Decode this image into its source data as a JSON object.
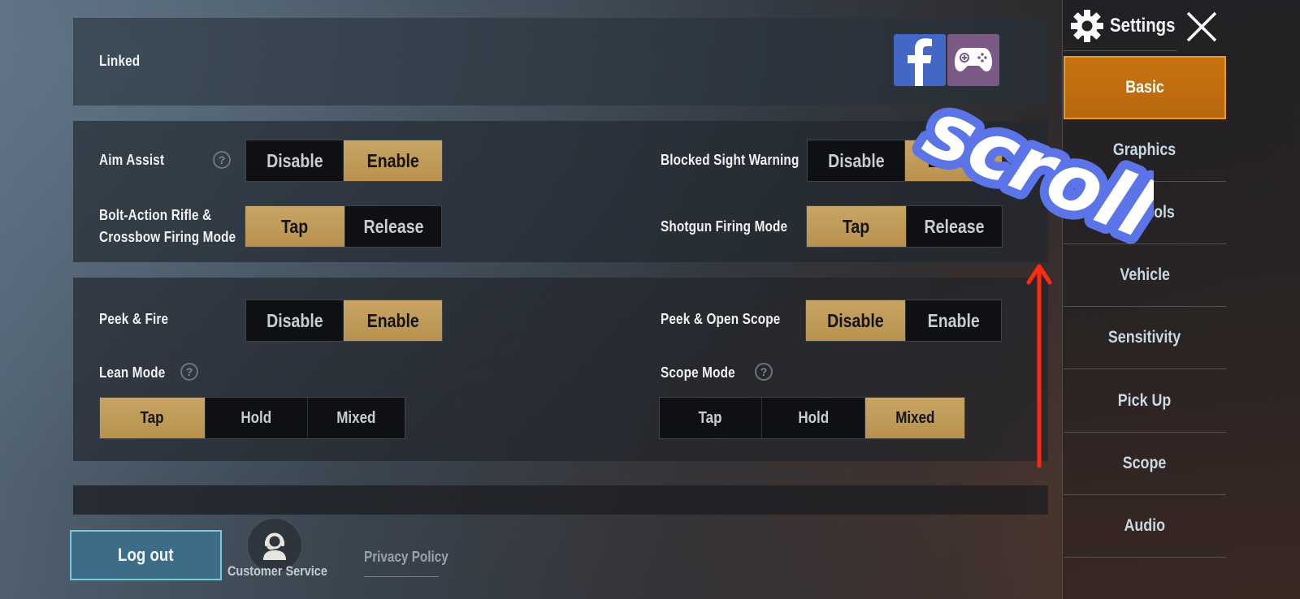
{
  "linked": {
    "label": "Linked",
    "accounts": [
      {
        "name": "facebook-icon",
        "color": "#4267c4"
      },
      {
        "name": "gamepad-icon",
        "color": "#7a5a85"
      }
    ]
  },
  "settings": {
    "aim_assist": {
      "label": "Aim Assist",
      "options": [
        "Disable",
        "Enable"
      ],
      "selected": "Enable",
      "help": "?"
    },
    "bolt_action": {
      "label_line1": "Bolt-Action Rifle &",
      "label_line2": "Crossbow Firing Mode",
      "options": [
        "Tap",
        "Release"
      ],
      "selected": "Tap"
    },
    "blocked_sight": {
      "label": "Blocked Sight Warning",
      "options": [
        "Disable",
        "Enable"
      ],
      "selected": "Enable"
    },
    "shotgun": {
      "label": "Shotgun Firing Mode",
      "options": [
        "Tap",
        "Release"
      ],
      "selected": "Tap"
    },
    "peek_fire": {
      "label": "Peek & Fire",
      "options": [
        "Disable",
        "Enable"
      ],
      "selected": "Enable"
    },
    "peek_scope": {
      "label": "Peek & Open Scope",
      "options": [
        "Disable",
        "Enable"
      ],
      "selected": "Disable"
    },
    "lean_mode": {
      "label": "Lean Mode",
      "options": [
        "Tap",
        "Hold",
        "Mixed"
      ],
      "selected": "Tap",
      "help": "?"
    },
    "scope_mode": {
      "label": "Scope Mode",
      "options": [
        "Tap",
        "Hold",
        "Mixed"
      ],
      "selected": "Mixed",
      "help": "?"
    }
  },
  "sidebar": {
    "title": "Settings",
    "items": [
      {
        "label": "Basic",
        "active": true
      },
      {
        "label": "Graphics",
        "active": false
      },
      {
        "label": "Controls",
        "active": false
      },
      {
        "label": "Vehicle",
        "active": false
      },
      {
        "label": "Sensitivity",
        "active": false
      },
      {
        "label": "Pick Up",
        "active": false
      },
      {
        "label": "Scope",
        "active": false
      },
      {
        "label": "Audio",
        "active": false
      }
    ]
  },
  "footer": {
    "logout_label": "Log out",
    "customer_service_label": "Customer Service",
    "privacy_label": "Privacy Policy"
  },
  "annotation": {
    "text": "scroll",
    "text_color": "#ffffff",
    "outline_color": "#5b74e8",
    "arrow_color": "#ff2a10"
  },
  "colors": {
    "accent_gold": "#c9a463",
    "sidebar_active": "#c6720f",
    "logout_bg": "#3c6c86"
  }
}
